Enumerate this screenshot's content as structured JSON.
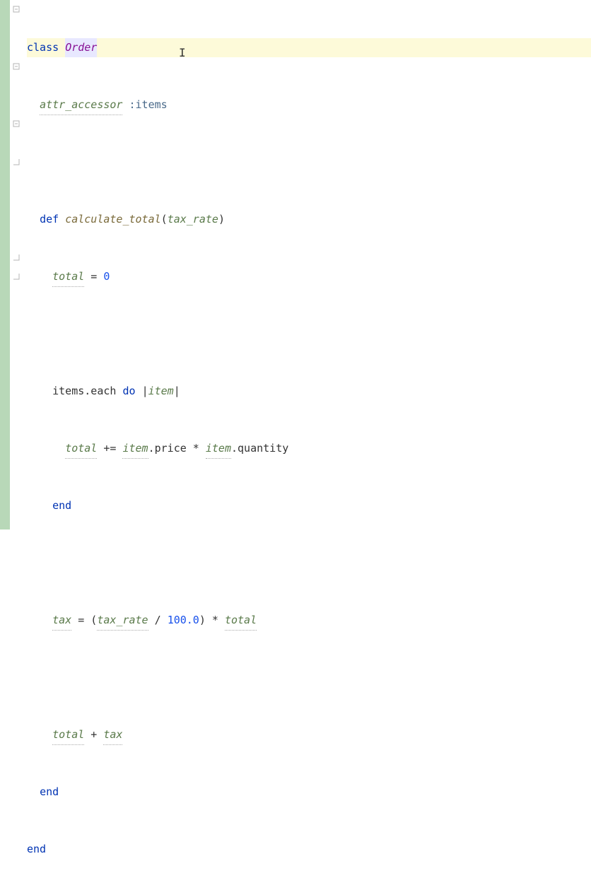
{
  "gutter": {
    "icons": [
      {
        "line": 0,
        "type": "collapse"
      },
      {
        "line": 3,
        "type": "collapse"
      },
      {
        "line": 6,
        "type": "collapse"
      },
      {
        "line": 8,
        "type": "expand-up"
      },
      {
        "line": 13,
        "type": "expand-up"
      },
      {
        "line": 14,
        "type": "expand-up"
      }
    ]
  },
  "code": {
    "l0_kw": "class",
    "l0_name": "Order",
    "l1_attr": "attr_accessor",
    "l1_sym": ":items",
    "l3_kw": "def",
    "l3_name": "calculate_total",
    "l3_param": "tax_rate",
    "l4_var": "total",
    "l4_op": " = ",
    "l4_val": "0",
    "l6_items": "items",
    "l6_each": ".each",
    "l6_do": "do",
    "l6_pipe": "|",
    "l6_param": "item",
    "l7_total": "total",
    "l7_op": " += ",
    "l7_item1": "item",
    "l7_price": ".price",
    "l7_mul": " * ",
    "l7_item2": "item",
    "l7_qty": ".quantity",
    "l8_end": "end",
    "l10_tax": "tax",
    "l10_op1": " = (",
    "l10_rate": "tax_rate",
    "l10_div": " / ",
    "l10_num": "100.0",
    "l10_op2": ") * ",
    "l10_total": "total",
    "l12_total": "total",
    "l12_op": " + ",
    "l12_tax": "tax",
    "l13_end": "end",
    "l14_end": "end"
  }
}
